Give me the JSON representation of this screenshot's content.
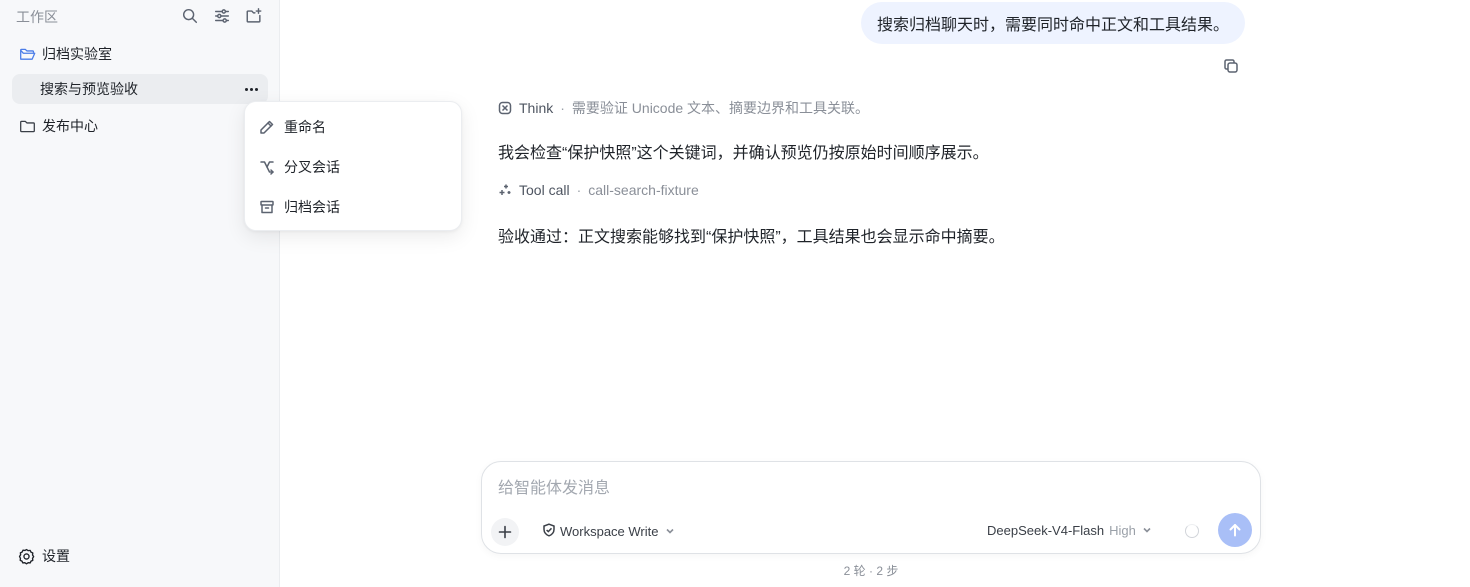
{
  "sidebar": {
    "workspace_title": "工作区",
    "folders": [
      {
        "label": "归档实验室",
        "open": true
      },
      {
        "label": "搜索与预览验收"
      },
      {
        "label": "发布中心",
        "open": false
      }
    ],
    "settings_label": "设置"
  },
  "context_menu": {
    "items": [
      {
        "label": "重命名",
        "icon": "pencil-icon"
      },
      {
        "label": "分叉会话",
        "icon": "fork-icon"
      },
      {
        "label": "归档会话",
        "icon": "archive-icon"
      }
    ]
  },
  "chat": {
    "user_message": "搜索归档聊天时，需要同时命中正文和工具结果。",
    "think": {
      "label": "Think",
      "detail": "需要验证 Unicode 文本、摘要边界和工具关联。"
    },
    "reply_1": "我会检查“保护快照”这个关键词，并确认预览仍按原始时间顺序展示。",
    "tool_call": {
      "label": "Tool call",
      "detail": "call-search-fixture"
    },
    "reply_2": "验收通过：正文搜索能够找到“保护快照”，工具结果也会显示命中摘要。"
  },
  "composer": {
    "placeholder": "给智能体发消息",
    "mode": "Workspace Write",
    "model": "DeepSeek-V4-Flash",
    "effort": "High",
    "stats": "2 轮 · 2 步"
  },
  "colors": {
    "accent_send": "#a9bff7",
    "user_bubble": "#eef3ff",
    "folder_open": "#4a7ce8"
  }
}
